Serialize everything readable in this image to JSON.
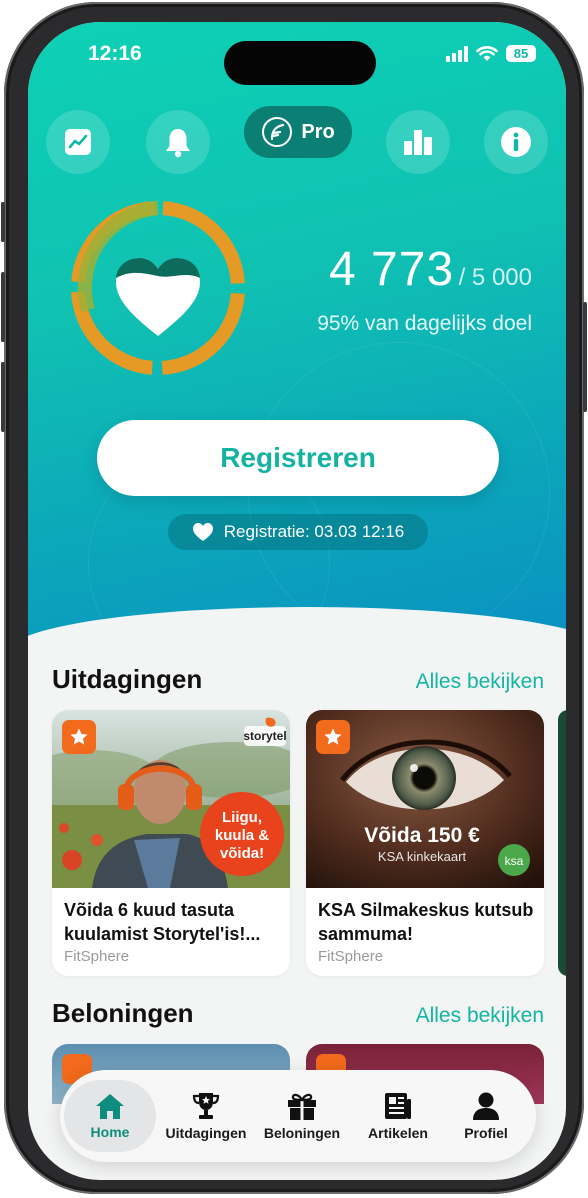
{
  "status": {
    "time": "12:16",
    "battery": "85"
  },
  "top_icons": [
    "trend-icon",
    "bell-icon",
    "bar-chart-icon",
    "info-icon"
  ],
  "pro": {
    "label": "Pro"
  },
  "progress": {
    "steps": "4 773",
    "goal": "/ 5 000",
    "percent_label": "95% van dagelijks doel",
    "fraction": 0.95
  },
  "register": {
    "button_label": "Registreren",
    "last_registration": "Registratie: 03.03 12:16"
  },
  "challenges": {
    "title": "Uitdagingen",
    "view_all": "Alles bekijken",
    "cards": [
      {
        "title": "Võida 6 kuud tasuta kuulamist Storytel'is!...",
        "source": "FitSphere",
        "brand": "storytel",
        "bubble": "Liigu, kuula & võida!"
      },
      {
        "title": "KSA Silmakeskus kutsub sammuma!",
        "source": "FitSphere",
        "prize": "Võida 150 €",
        "prize_sub": "KSA kinkekaart",
        "logo": "ksa"
      }
    ]
  },
  "rewards": {
    "title": "Beloningen",
    "view_all": "Alles bekijken"
  },
  "nav": [
    {
      "label": "Home",
      "icon": "home-icon",
      "active": true
    },
    {
      "label": "Uitdagingen",
      "icon": "trophy-icon",
      "active": false
    },
    {
      "label": "Beloningen",
      "icon": "gift-icon",
      "active": false
    },
    {
      "label": "Artikelen",
      "icon": "newspaper-icon",
      "active": false
    },
    {
      "label": "Profiel",
      "icon": "person-icon",
      "active": false
    }
  ],
  "colors": {
    "accent": "#12b6a2",
    "ring_orange": "#f7a21b",
    "badge_orange": "#f26a1b"
  }
}
